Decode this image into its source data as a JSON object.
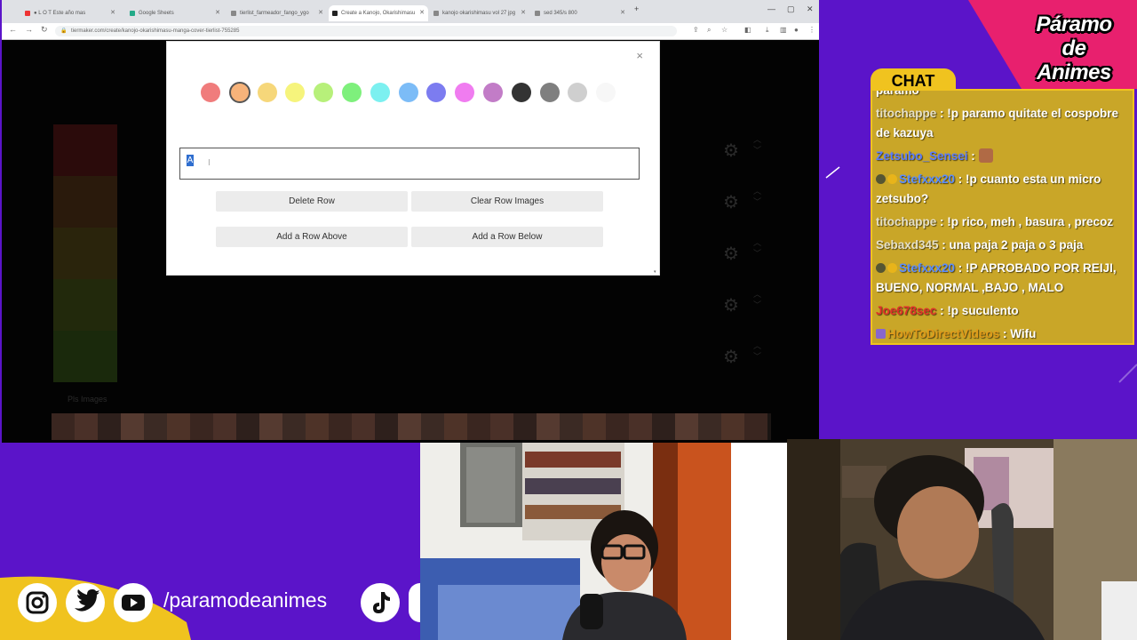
{
  "browser": {
    "tabs": [
      {
        "label": "● L O T  Este año mas"
      },
      {
        "label": "Google Sheets"
      },
      {
        "label": "tierlist_farmeador_fango_ygo"
      },
      {
        "label": "Create a Kanojo, Okarishimasu"
      },
      {
        "label": "kanojo okarishimasu vol 27 jpg"
      },
      {
        "label": "sed 345/s 800"
      }
    ],
    "url": "tiermaker.com/create/kanojo-okarishimasu-manga-cover-tierlist-755285",
    "window_controls": [
      "—",
      "▢",
      "✕"
    ],
    "new_tab": "+"
  },
  "tierlist": {
    "rows": [
      "",
      "",
      "",
      "",
      ""
    ],
    "pool_label": "Pls Images"
  },
  "modal": {
    "close": "×",
    "swatch_colors": [
      "#f07c7c",
      "#f7b37a",
      "#f6d77a",
      "#f6f47c",
      "#b7f07a",
      "#7ef07c",
      "#7cf0f0",
      "#7cbcf7",
      "#7c7cf0",
      "#f07cf0",
      "#c27cc7",
      "#333333",
      "#7f7f7f",
      "#cfcfcf",
      "#f7f7f7"
    ],
    "selected_swatch": 1,
    "input_value": "A",
    "buttons": {
      "delete_row": "Delete Row",
      "clear_row_images": "Clear Row Images",
      "add_row_above": "Add a Row Above",
      "add_row_below": "Add a Row Below"
    }
  },
  "logo": {
    "line1": "Páramo",
    "line2": "de",
    "line3": "Animes"
  },
  "chat": {
    "title": "CHAT",
    "messages": [
      {
        "user": "",
        "text": "paramo"
      },
      {
        "user": "titochappe",
        "text": "!p paramo quitate el cospobre de kazuya"
      },
      {
        "user": "Zetsubo_Sensei",
        "text": ""
      },
      {
        "user": "Stefxxx20",
        "text": "!p cuanto esta un micro zetsubo?"
      },
      {
        "user": "titochappe",
        "text": "!p rico, meh , basura , precoz"
      },
      {
        "user": "Sebaxd345",
        "text": "una paja 2 paja o 3 paja"
      },
      {
        "user": "Stefxxx20",
        "text": "!P APROBADO POR REIJI, BUENO, NORMAL ,BAJO , MALO"
      },
      {
        "user": "Joe678sec",
        "text": "!p suculento"
      },
      {
        "user": "HowToDirectVideos",
        "text": "Wifu"
      }
    ],
    "colors": {
      "border": "#f0c31f",
      "bg": "#c9a628"
    }
  },
  "socials": {
    "icons": [
      "instagram-icon",
      "twitter-icon",
      "youtube-icon",
      "tiktok-icon"
    ],
    "handle": "/paramodeanimes"
  },
  "theme": {
    "bg_purple": "#5b14c9",
    "accent_pink": "#e8206e",
    "accent_yellow": "#f0c31f"
  }
}
